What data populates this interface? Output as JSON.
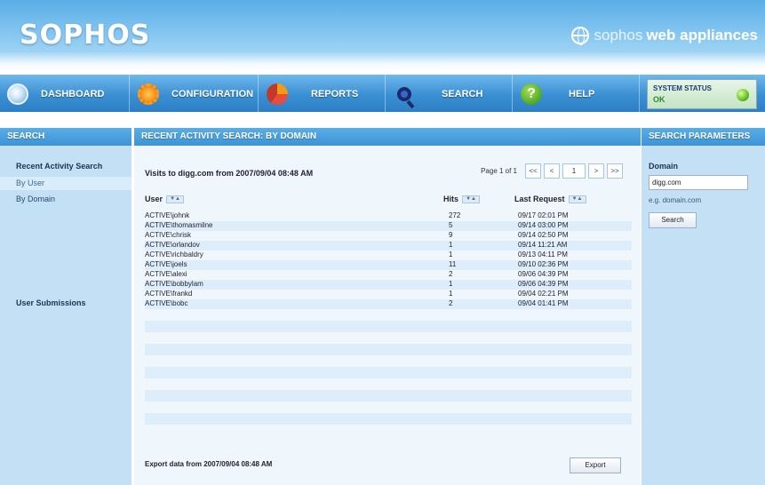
{
  "header": {
    "logo": "SOPHOS",
    "brand_light": "sophos",
    "brand_bold": "web appliances"
  },
  "nav": {
    "items": [
      {
        "label": "DASHBOARD",
        "icon": "dashboard-icon"
      },
      {
        "label": "CONFIGURATION",
        "icon": "gear-icon"
      },
      {
        "label": "REPORTS",
        "icon": "pie-chart-icon"
      },
      {
        "label": "SEARCH",
        "icon": "magnifier-icon"
      },
      {
        "label": "HELP",
        "icon": "help-icon"
      }
    ],
    "help_glyph": "?",
    "status_title": "SYSTEM STATUS",
    "status_value": "OK"
  },
  "left": {
    "title": "SEARCH",
    "recent_activity": "Recent Activity Search",
    "by_user": "By User",
    "by_domain": "By Domain",
    "user_submissions": "User Submissions"
  },
  "main": {
    "title": "RECENT ACTIVITY SEARCH: BY DOMAIN",
    "visits_text": "Visits to digg.com from 2007/09/04 08:48 AM",
    "pager": {
      "text": "Page 1 of 1",
      "first": "<<",
      "prev": "<",
      "page": "1",
      "next": ">",
      "last": ">>"
    },
    "columns": {
      "user": "User",
      "hits": "Hits",
      "last": "Last Request"
    },
    "sort_glyph": "▼▲",
    "rows": [
      {
        "user": "ACTIVE\\johnk",
        "hits": "272",
        "last": "09/17 02:01 PM"
      },
      {
        "user": "ACTIVE\\thomasmilne",
        "hits": "5",
        "last": "09/14 03:00 PM"
      },
      {
        "user": "ACTIVE\\chrisk",
        "hits": "9",
        "last": "09/14 02:50 PM"
      },
      {
        "user": "ACTIVE\\orlandov",
        "hits": "1",
        "last": "09/14 11:21 AM"
      },
      {
        "user": "ACTIVE\\richbaldry",
        "hits": "1",
        "last": "09/13 04:11 PM"
      },
      {
        "user": "ACTIVE\\joels",
        "hits": "11",
        "last": "09/10 02:36 PM"
      },
      {
        "user": "ACTIVE\\alexi",
        "hits": "2",
        "last": "09/06 04:39 PM"
      },
      {
        "user": "ACTIVE\\bobbylam",
        "hits": "1",
        "last": "09/06 04:39 PM"
      },
      {
        "user": "ACTIVE\\frankd",
        "hits": "1",
        "last": "09/04 02:21 PM"
      },
      {
        "user": "ACTIVE\\bobc",
        "hits": "2",
        "last": "09/04 01:41 PM"
      }
    ],
    "export_text": "Export data from 2007/09/04 08:48 AM",
    "export_button": "Export"
  },
  "right": {
    "title": "SEARCH PARAMETERS",
    "domain_label": "Domain",
    "domain_value": "digg.com",
    "hint": "e.g. domain.com",
    "search_button": "Search"
  }
}
